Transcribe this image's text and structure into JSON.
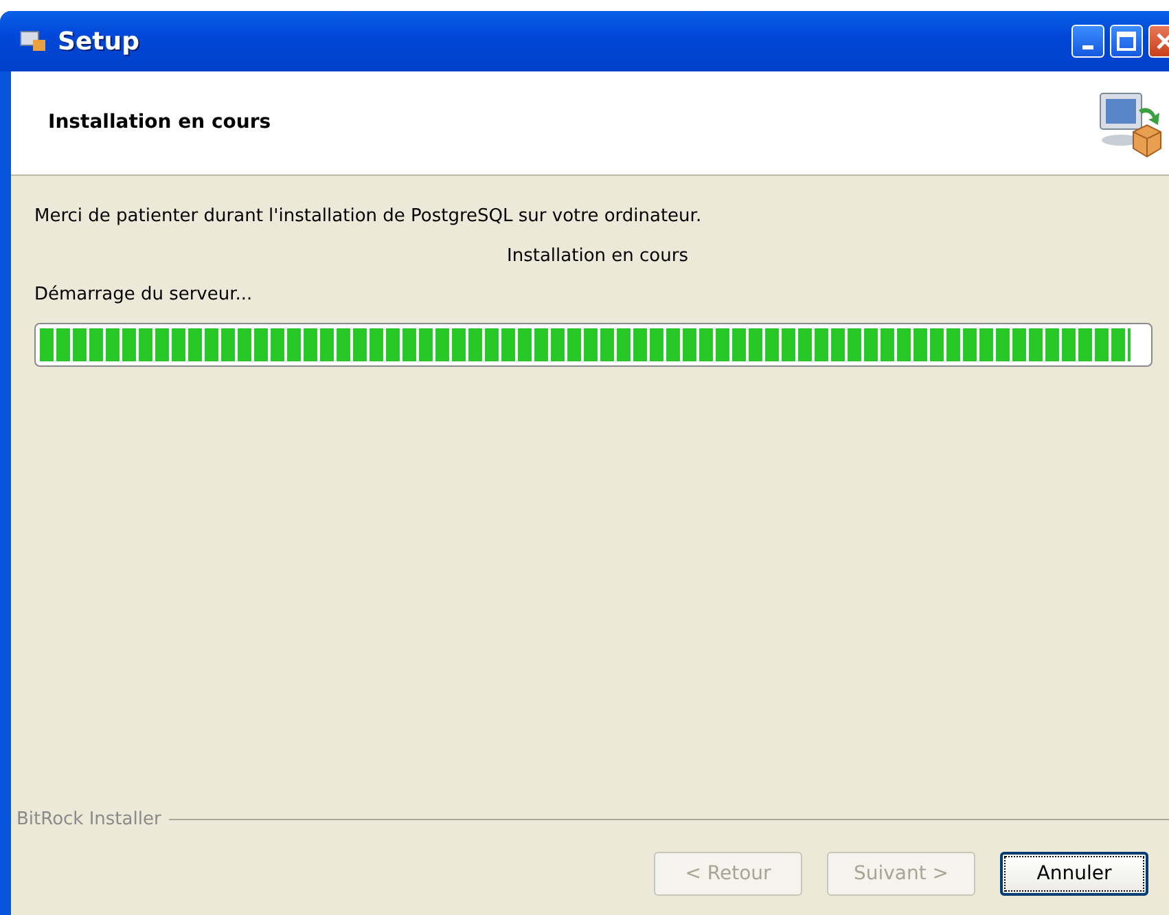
{
  "window": {
    "title": "Setup"
  },
  "header": {
    "title": "Installation en cours"
  },
  "message": "Merci de patienter durant l'installation de PostgreSQL sur votre ordinateur.",
  "stage": "Installation en cours",
  "status": "Démarrage du serveur...",
  "progress": {
    "level": 0.985
  },
  "footer": {
    "label": "BitRock Installer"
  },
  "buttons": [
    {
      "label": "< Retour",
      "disabled": true,
      "default": false
    },
    {
      "label": "Suivant >",
      "disabled": true,
      "default": false
    },
    {
      "label": "Annuler",
      "disabled": false,
      "default": true
    }
  ]
}
